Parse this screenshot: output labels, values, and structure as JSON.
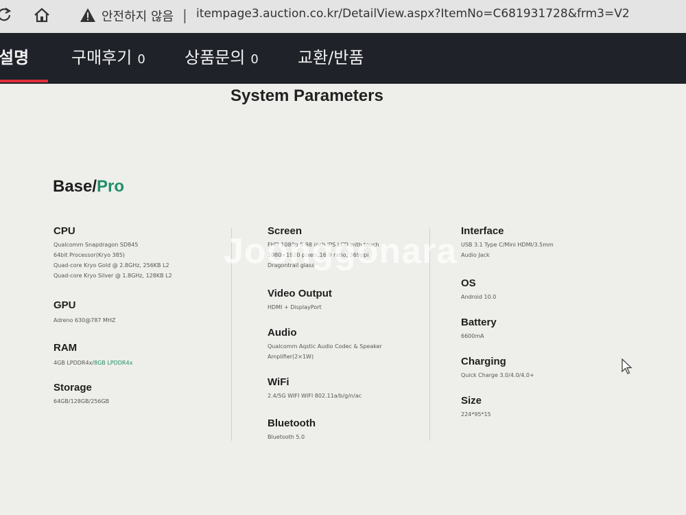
{
  "browser": {
    "security_text": "안전하지 않음",
    "url": "itempage3.auction.co.kr/DetailView.aspx?ItemNo=C681931728&frm3=V2"
  },
  "tabs": [
    {
      "label": "설명",
      "count": ""
    },
    {
      "label": "구매후기",
      "count": "0"
    },
    {
      "label": "상품문의",
      "count": "0"
    },
    {
      "label": "교환/반품",
      "count": ""
    }
  ],
  "section_title": "System Parameters",
  "model": {
    "base": "Base/",
    "pro": "Pro"
  },
  "watermark": "Joonggonara",
  "specs": {
    "cpu": {
      "title": "CPU",
      "lines": [
        "Qualcomm Snapdragon SD845",
        "64bit Processor(Kryo 385)",
        "Quad-core Kryo Gold @ 2.8GHz, 256KB L2",
        "Quad-core Kryo Silver @ 1.8GHz, 128KB L2"
      ]
    },
    "gpu": {
      "title": "GPU",
      "lines": [
        "Adreno 630@787 MHZ"
      ]
    },
    "ram": {
      "title": "RAM",
      "line_main": "4GB LPDDR4x/",
      "line_accent": "8GB LPDDR4x"
    },
    "storage": {
      "title": "Storage",
      "lines": [
        "64GB/128GB/256GB"
      ]
    },
    "screen": {
      "title": "Screen",
      "lines": [
        "FHD 1080p 5.98 inch IPS LCD with touch",
        "1080×1920 pixels,16:9 ratio, 369ppi",
        "Dragontrail glass"
      ]
    },
    "video": {
      "title": "Video Output",
      "lines": [
        "HDMI + DisplayPort"
      ]
    },
    "audio": {
      "title": "Audio",
      "lines": [
        "Qualcomm Aqstic Audio Codec & Speaker",
        "Amplifier(2×1W)"
      ]
    },
    "wifi": {
      "title": "WiFi",
      "lines": [
        "2.4/5G WIFI   WIFI 802.11a/b/g/n/ac"
      ]
    },
    "bluetooth": {
      "title": "Bluetooth",
      "lines": [
        "Bluetooth 5.0"
      ]
    },
    "interface": {
      "title": "Interface",
      "lines": [
        "USB 3.1 Type C/Mini HDMI/3.5mm",
        "Audio Jack"
      ]
    },
    "os": {
      "title": "OS",
      "lines": [
        "Android 10.0"
      ]
    },
    "battery": {
      "title": "Battery",
      "lines": [
        "6600mA"
      ]
    },
    "charging": {
      "title": "Charging",
      "lines": [
        "Quick Charge 3.0/4.0/4.0+"
      ]
    },
    "size": {
      "title": "Size",
      "lines": [
        "224*95*15"
      ]
    }
  },
  "colors": {
    "nav_bg": "#1f2229",
    "active_underline": "#e0303a",
    "accent_green": "#1f8f6a"
  }
}
